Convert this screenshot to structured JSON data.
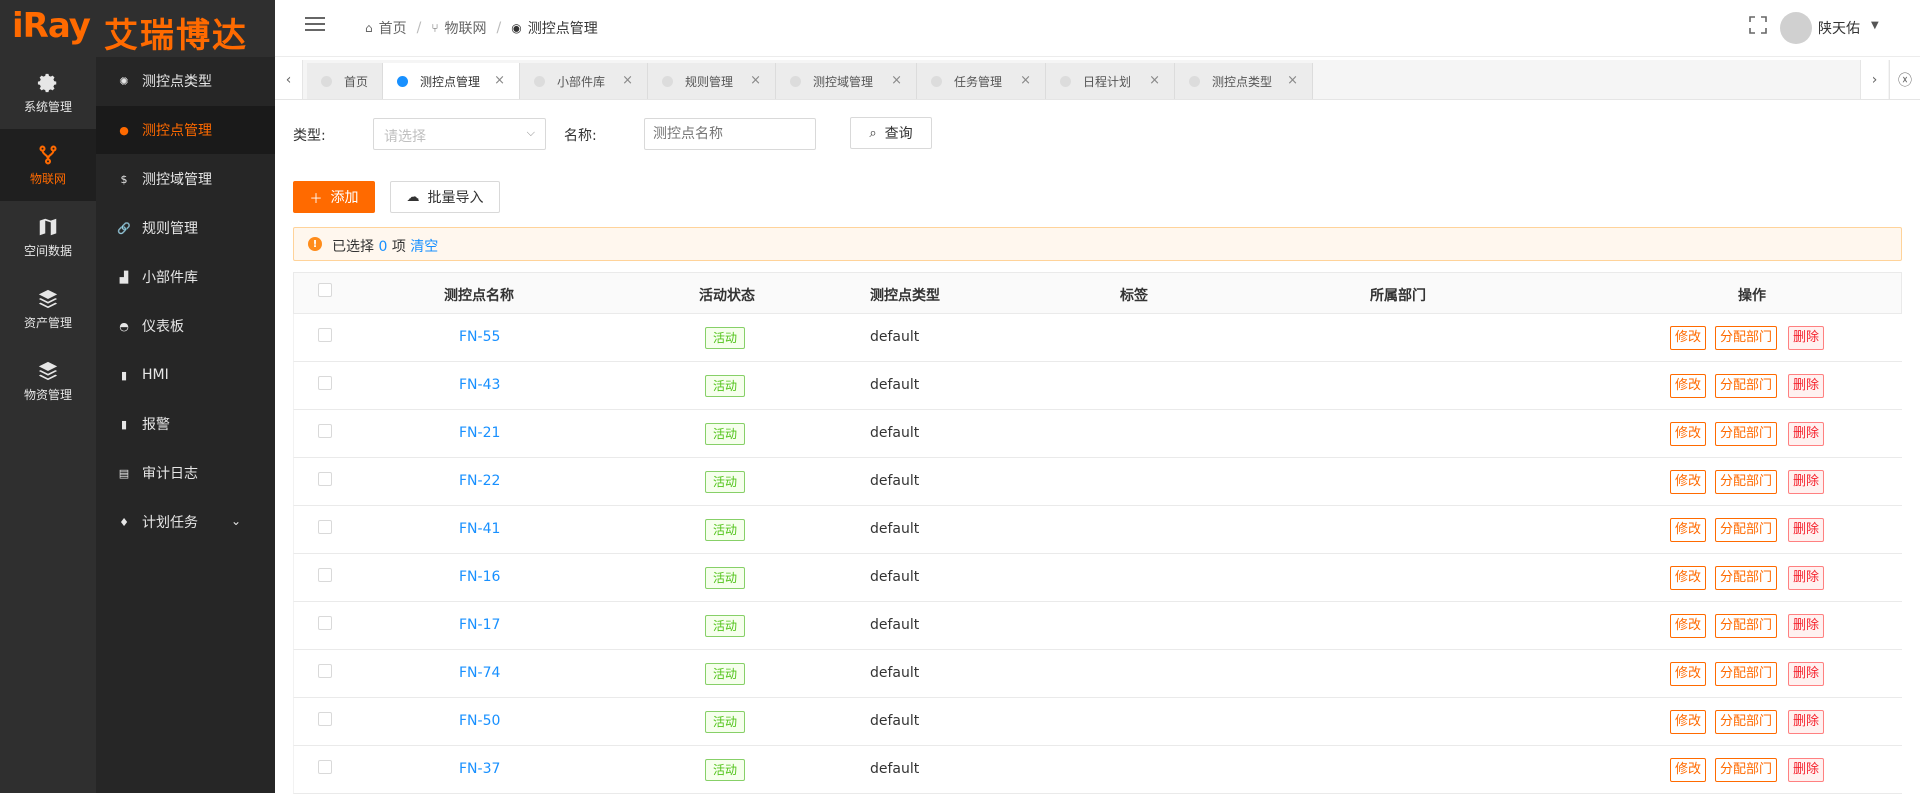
{
  "brand": {
    "logo_en": "iRay",
    "logo_cn": "艾瑞博达",
    "color": "#ff6a00"
  },
  "rail": [
    {
      "label": "系统管理",
      "icon": "gear-icon",
      "active": false
    },
    {
      "label": "物联网",
      "icon": "fork-icon",
      "active": true
    },
    {
      "label": "空间数据",
      "icon": "map-icon",
      "active": false
    },
    {
      "label": "资产管理",
      "icon": "layers-icon",
      "active": false
    },
    {
      "label": "物资管理",
      "icon": "layers-icon",
      "active": false
    }
  ],
  "submenu": [
    {
      "label": "测控点类型",
      "icon": "aperture-icon"
    },
    {
      "label": "测控点管理",
      "icon": "dot-icon"
    },
    {
      "label": "测控域管理",
      "icon": "dollar-icon"
    },
    {
      "label": "规则管理",
      "icon": "link-icon"
    },
    {
      "label": "小部件库",
      "icon": "bar-chart-icon"
    },
    {
      "label": "仪表板",
      "icon": "dashboard-icon"
    },
    {
      "label": "HMI",
      "icon": "battery-icon"
    },
    {
      "label": "报警",
      "icon": "battery-icon"
    },
    {
      "label": "审计日志",
      "icon": "document-icon"
    },
    {
      "label": "计划任务",
      "icon": "person-icon"
    }
  ],
  "header": {
    "breadcrumb": [
      "首页",
      "物联网",
      "测控点管理"
    ],
    "username": "陕天佑"
  },
  "tabs": [
    {
      "label": "首页",
      "closable": false,
      "active": false
    },
    {
      "label": "测控点管理",
      "closable": true,
      "active": true
    },
    {
      "label": "小部件库",
      "closable": true,
      "active": false
    },
    {
      "label": "规则管理",
      "closable": true,
      "active": false
    },
    {
      "label": "测控域管理",
      "closable": true,
      "active": false
    },
    {
      "label": "任务管理",
      "closable": true,
      "active": false
    },
    {
      "label": "日程计划",
      "closable": true,
      "active": false
    },
    {
      "label": "测控点类型",
      "closable": true,
      "active": false
    }
  ],
  "filters": {
    "type_label": "类型:",
    "type_placeholder": "请选择",
    "name_label": "名称:",
    "name_placeholder": "测控点名称",
    "query_label": "查询"
  },
  "actions": {
    "add_label": "添加",
    "import_label": "批量导入"
  },
  "selection": {
    "prefix": "已选择",
    "count": "0",
    "unit": "项",
    "clear": "清空"
  },
  "table": {
    "columns": [
      "测控点名称",
      "活动状态",
      "测控点类型",
      "标签",
      "所属部门",
      "操作"
    ],
    "rows": [
      {
        "name": "FN-55",
        "status": "活动",
        "type": "default"
      },
      {
        "name": "FN-43",
        "status": "活动",
        "type": "default"
      },
      {
        "name": "FN-21",
        "status": "活动",
        "type": "default"
      },
      {
        "name": "FN-22",
        "status": "活动",
        "type": "default"
      },
      {
        "name": "FN-41",
        "status": "活动",
        "type": "default"
      },
      {
        "name": "FN-16",
        "status": "活动",
        "type": "default"
      },
      {
        "name": "FN-17",
        "status": "活动",
        "type": "default"
      },
      {
        "name": "FN-74",
        "status": "活动",
        "type": "default"
      },
      {
        "name": "FN-50",
        "status": "活动",
        "type": "default"
      },
      {
        "name": "FN-37",
        "status": "活动",
        "type": "default"
      }
    ],
    "row_actions": {
      "edit": "修改",
      "assign": "分配部门",
      "delete": "删除"
    }
  }
}
